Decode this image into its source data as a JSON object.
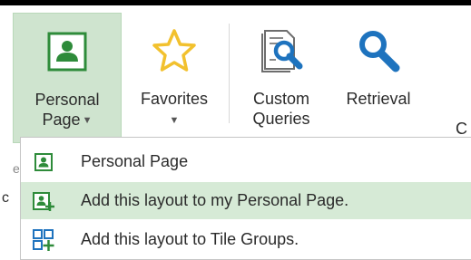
{
  "ribbon": {
    "personal_page": {
      "line1": "Personal",
      "line2": "Page",
      "icon": "personal-page-icon"
    },
    "favorites": {
      "label": "Favorites",
      "icon": "star-icon"
    },
    "custom_queries": {
      "line1": "Custom",
      "line2": "Queries",
      "icon": "document-search-icon"
    },
    "retrieval": {
      "label": "Retrieval",
      "icon": "magnifier-icon"
    },
    "cut_label": "C"
  },
  "menu": {
    "items": [
      {
        "label": "Personal Page",
        "icon": "personal-page-icon"
      },
      {
        "label": "Add this layout to my Personal Page.",
        "icon": "add-to-personal-page-icon"
      },
      {
        "label": "Add this layout to Tile Groups.",
        "icon": "add-to-tile-groups-icon"
      }
    ]
  },
  "colors": {
    "accent_green": "#2e8b3a",
    "hover_green": "#d6ead6",
    "selected_button": "#cfe4cf",
    "blue_icon": "#1e73be",
    "star_yellow": "#f2c12e"
  }
}
